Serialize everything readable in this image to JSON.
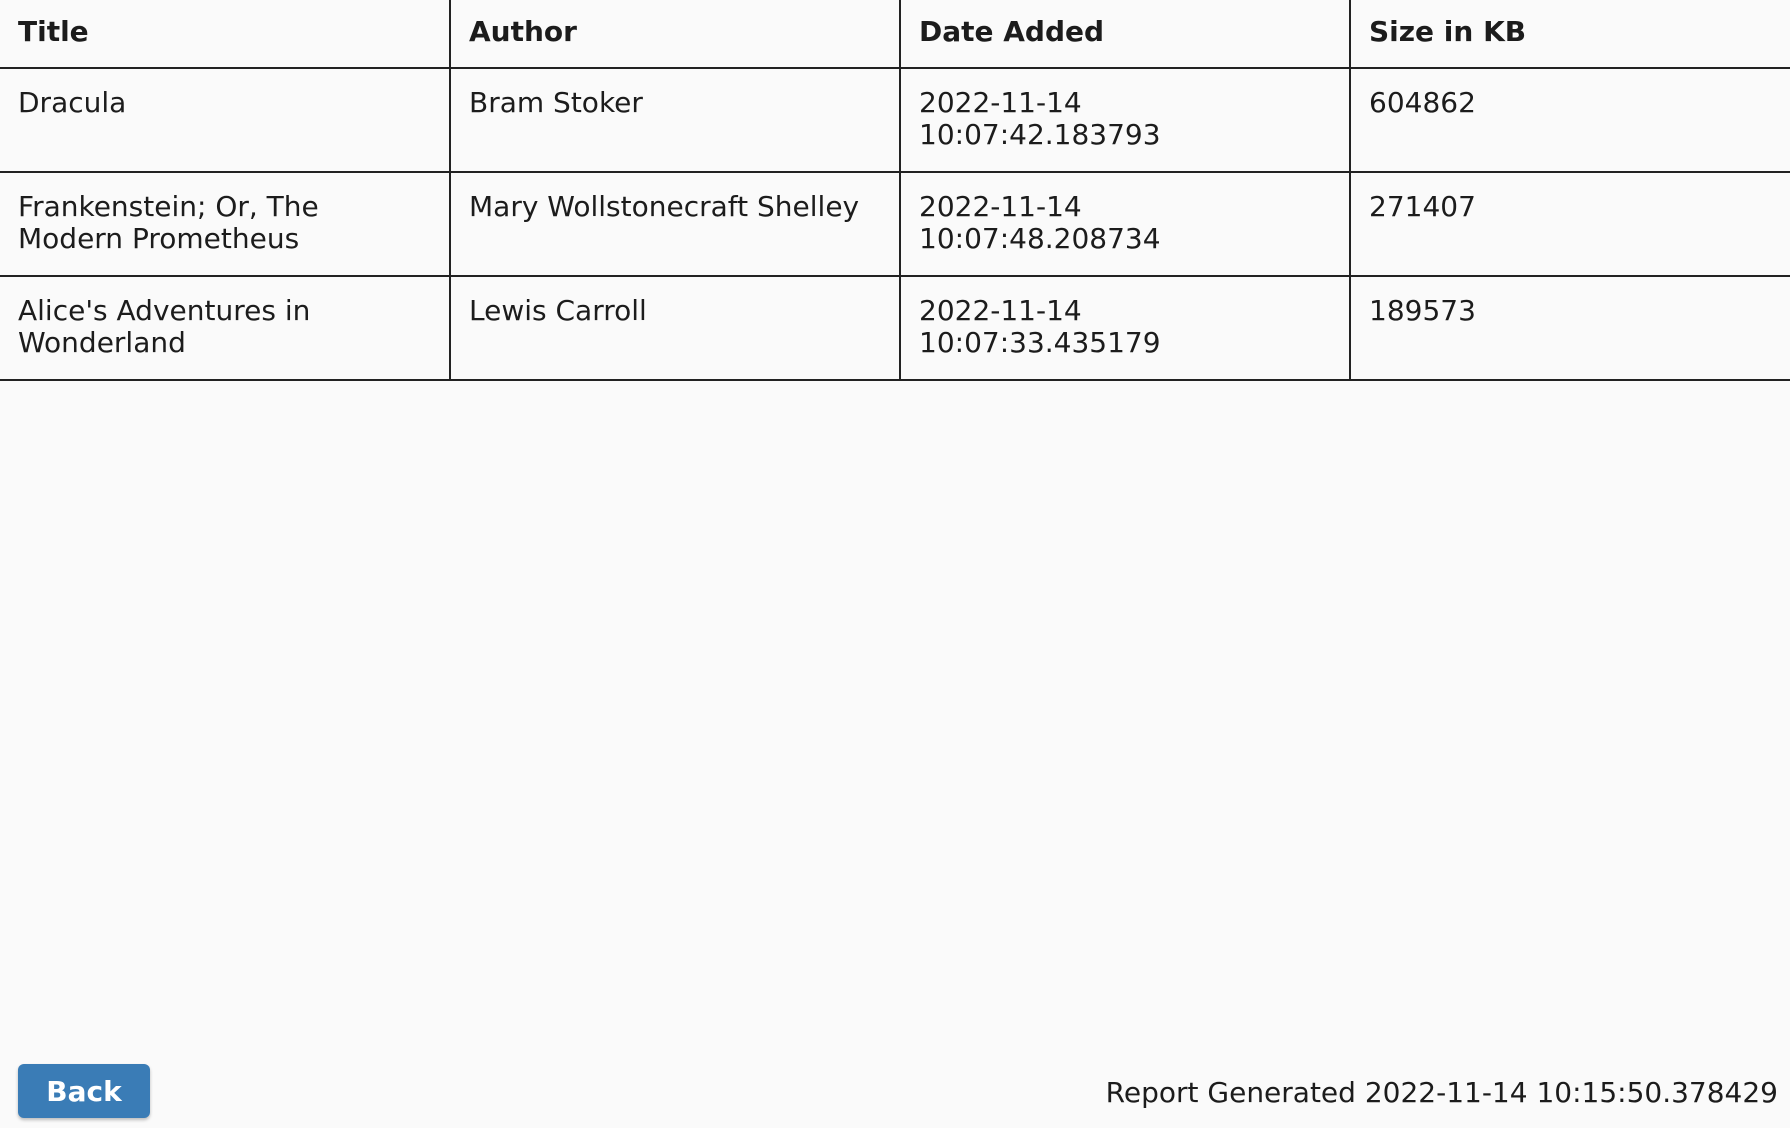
{
  "table": {
    "headers": [
      "Title",
      "Author",
      "Date Added",
      "Size in KB"
    ],
    "rows": [
      [
        "Dracula",
        "Bram Stoker",
        "2022-11-14 10:07:42.183793",
        "604862"
      ],
      [
        "Frankenstein; Or, The Modern Prometheus",
        "Mary Wollstonecraft Shelley",
        "2022-11-14 10:07:48.208734",
        "271407"
      ],
      [
        "Alice's Adventures in Wonderland",
        "Lewis Carroll",
        "2022-11-14 10:07:33.435179",
        "189573"
      ]
    ]
  },
  "footer": {
    "back_label": "Back",
    "report_generated": "Report Generated 2022-11-14 10:15:50.378429"
  },
  "colors": {
    "button_background": "#3a7cb6",
    "page_background": "#fafafa",
    "border": "#222222"
  }
}
